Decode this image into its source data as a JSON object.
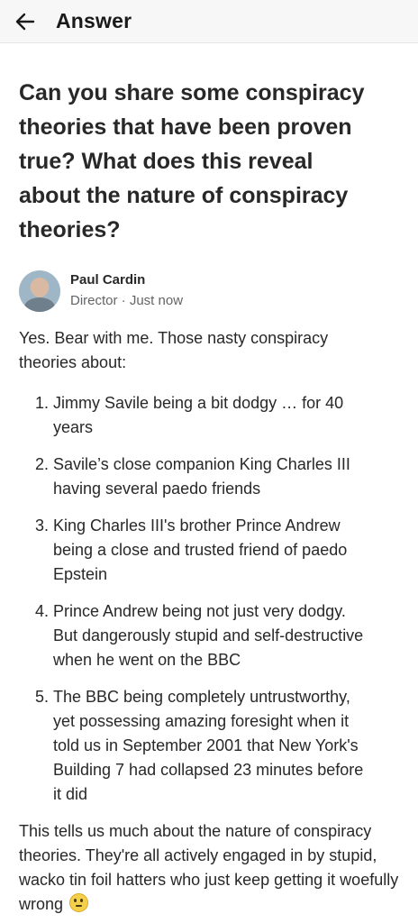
{
  "header": {
    "title": "Answer",
    "back_icon": "arrow-left-icon"
  },
  "question": {
    "text": "Can you share some conspiracy theories that have been proven true? What does this reveal about the nature of conspiracy theories?"
  },
  "author": {
    "name": "Paul Cardin",
    "subtitle": "Director · Just now",
    "avatar": "profile-photo"
  },
  "answer": {
    "intro": "Yes. Bear with me. Those nasty conspiracy theories about:",
    "points": [
      {
        "num": "1.",
        "text": "Jimmy Savile being a bit dodgy … for 40 years"
      },
      {
        "num": "2.",
        "text": "Savile’s close companion King Charles III having several paedo friends"
      },
      {
        "num": "3.",
        "text": "King Charles III's brother Prince Andrew being a close and trusted friend of paedo Epstein"
      },
      {
        "num": "4.",
        "text": "Prince Andrew being not just very dodgy. But dangerously stupid and self-destructive when he went on the BBC"
      },
      {
        "num": "5.",
        "text": "The BBC being completely untrustworthy, yet possessing amazing foresight when it told us in September 2001 that New York's Building 7 had collapsed 23 minutes before it did"
      }
    ],
    "outro": "This tells us much about the nature of conspiracy theories. They're all actively engaged in by stupid, wacko tin foil hatters who just keep getting it woefully wrong",
    "outro_emoji": "eye-roll-emoji"
  }
}
